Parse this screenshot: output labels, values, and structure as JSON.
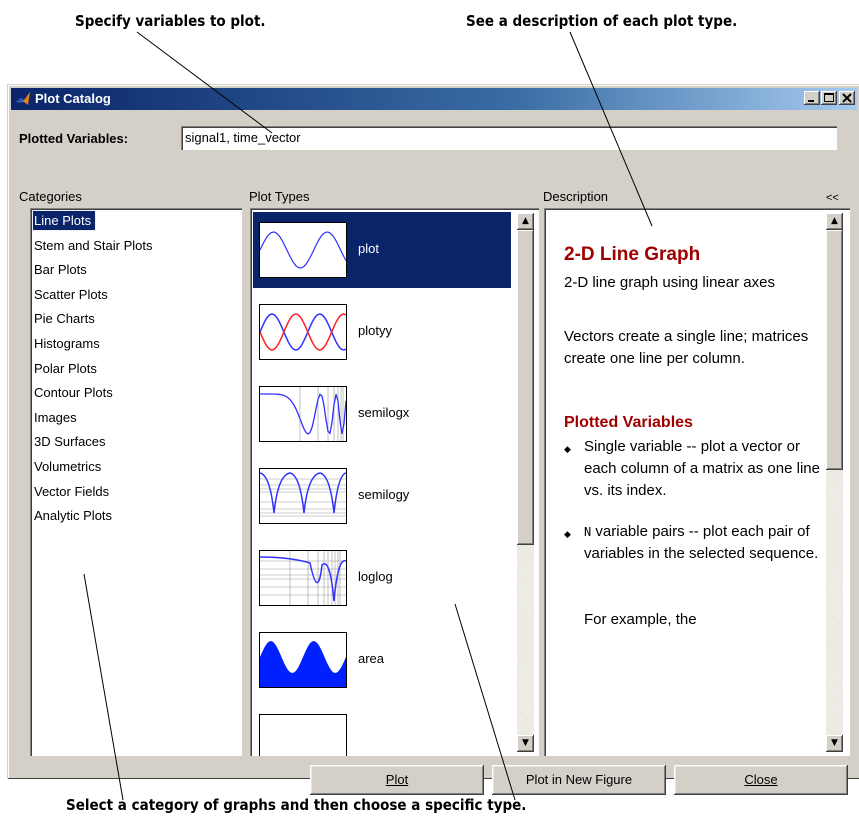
{
  "callouts": {
    "variables": "Specify variables to plot.",
    "description": "See a description of each plot type.",
    "select": "Select a category of graphs and then choose a specific type."
  },
  "window": {
    "title": "Plot Catalog",
    "minimize": "_",
    "maximize": "□",
    "close": "✕"
  },
  "plotted_variables": {
    "label": "Plotted Variables:",
    "value": "signal1, time_vector"
  },
  "categories": {
    "header": "Categories",
    "selected": "Line Plots",
    "items": [
      "Line Plots",
      "Stem and Stair Plots",
      "Bar Plots",
      "Scatter Plots",
      "Pie Charts",
      "Histograms",
      "Polar Plots",
      "Contour Plots",
      "Images",
      "3D Surfaces",
      "Volumetrics",
      "Vector Fields",
      "Analytic Plots"
    ]
  },
  "plot_types": {
    "header": "Plot Types",
    "selected": "plot",
    "items": [
      "plot",
      "plotyy",
      "semilogx",
      "semilogy",
      "loglog",
      "area"
    ]
  },
  "description": {
    "header": "Description",
    "collapse": "<<",
    "title": "2-D Line Graph",
    "subtitle": "2-D line graph using linear axes",
    "body": "Vectors create a single line; matrices create one line per column.",
    "section": "Plotted Variables",
    "bullet1": "Single variable -- plot a vector or each column of a matrix as one line vs. its index.",
    "bullet2_code": "N",
    "bullet2": " variable pairs -- plot each pair of variables in the selected sequence.",
    "tail": "For example, the"
  },
  "buttons": {
    "plot": "Plot",
    "plot_new": "Plot in New Figure",
    "close": "Close"
  },
  "colors": {
    "selection": "#0a246a",
    "dialog": "#d4d0c8",
    "heading_red": "#a00000",
    "plot_blue": "#3030ff",
    "plot_red": "#ff2020"
  }
}
